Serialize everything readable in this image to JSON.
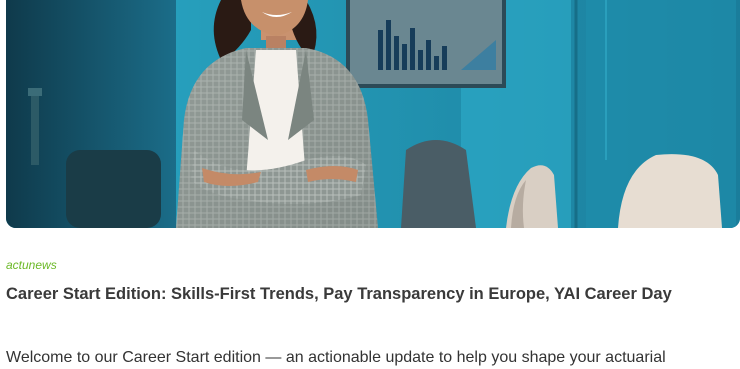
{
  "article": {
    "image_alt": "Smiling professional woman with crossed arms in a teal meeting room with a chart on the wall",
    "category": "actunews",
    "title": "Career Start Edition: Skills-First Trends, Pay Transparency in Europe, YAI Career Day",
    "excerpt": "Welcome to our Career Start edition — an actionable update to help you shape your actuarial"
  },
  "colors": {
    "category": "#6cb928",
    "title": "#3a3a3a",
    "text": "#333333",
    "hero_teal": "#1f89a6"
  }
}
